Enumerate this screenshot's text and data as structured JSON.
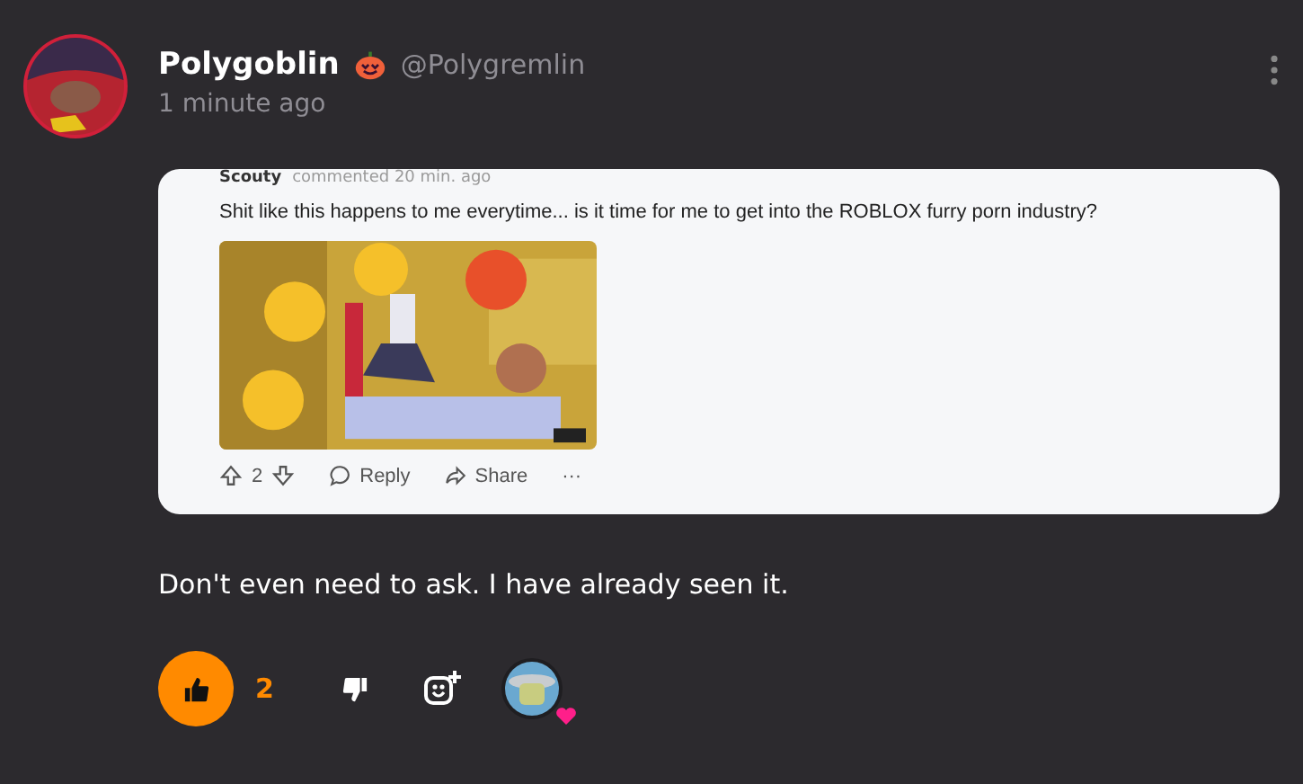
{
  "post": {
    "author": "Polygoblin",
    "handle": "@Polygremlin",
    "time": "1 minute ago"
  },
  "embed": {
    "author": "Scouty",
    "meta": "commented 20 min. ago",
    "text": "Shit like this happens to me everytime... is it time for me to get into the ROBLOX furry porn industry?",
    "votes": "2",
    "reply": "Reply",
    "share": "Share",
    "more": "···"
  },
  "comment": "Don't even need to ask. I have already seen it.",
  "actions": {
    "liked": true,
    "likes": "2"
  }
}
